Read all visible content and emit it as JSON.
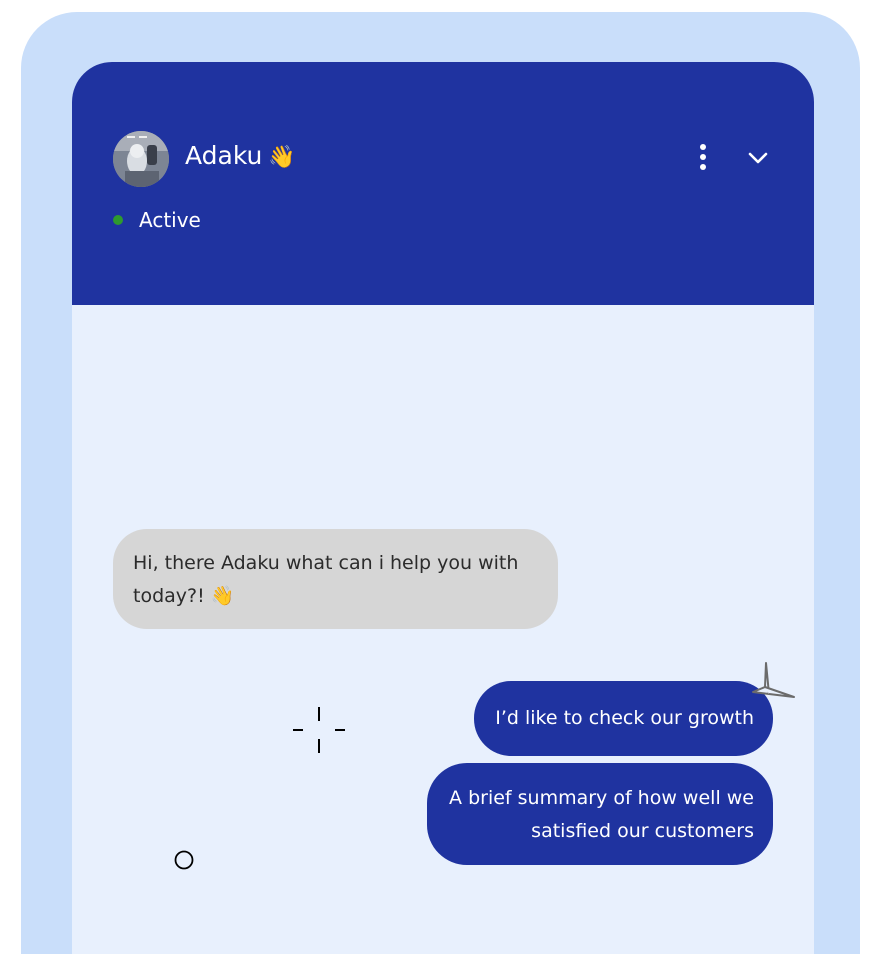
{
  "contact": {
    "name": "Adaku",
    "name_emoji": "👋",
    "status": "Active",
    "avatar_icon": "avatar-photo"
  },
  "header_actions": {
    "menu_icon": "more-vert-icon",
    "collapse_icon": "chevron-down-icon"
  },
  "messages": [
    {
      "direction": "incoming",
      "text": "Hi, there Adaku what can i help you with today?!",
      "emoji": "👋"
    },
    {
      "direction": "outgoing",
      "text": "I’d like to check our growth"
    },
    {
      "direction": "outgoing",
      "text": "A brief summary of how well we satisfied our customers"
    }
  ],
  "colors": {
    "outer_background": "#c9defa",
    "chat_background": "#e8f0fd",
    "header_background": "#1f33a0",
    "outgoing_bubble": "#1f33a0",
    "incoming_bubble": "#d6d6d6",
    "status_dot": "#2e9a2e"
  }
}
